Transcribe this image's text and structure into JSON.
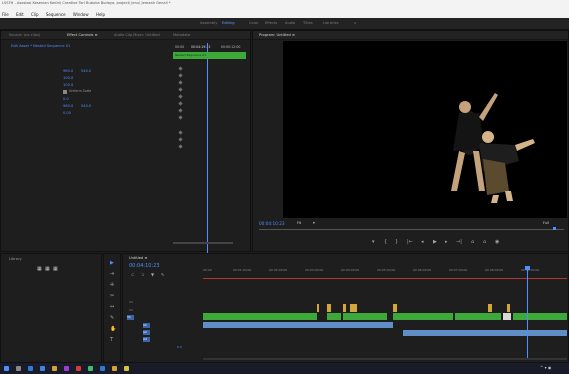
{
  "window": {
    "title": "LSSFH - Asosiasi Kesenian Kediri\\ Creative Tari Bubuka Budaya. project\\ Jenu\\ Jemaah Genail *"
  },
  "menu": [
    "File",
    "Edit",
    "Clip",
    "Sequence",
    "Window",
    "Help"
  ],
  "workspaces": [
    {
      "label": "Assembly",
      "active": false
    },
    {
      "label": "Editing",
      "active": true
    },
    {
      "label": "Color",
      "active": false
    },
    {
      "label": "Effects",
      "active": false
    },
    {
      "label": "Audio",
      "active": false
    },
    {
      "label": "Titles",
      "active": false
    },
    {
      "label": "Libraries",
      "active": false
    }
  ],
  "left_panel": {
    "tabs": [
      {
        "label": "Source: (no clips)",
        "active": false
      },
      {
        "label": "Effect Controls ≡",
        "active": true
      },
      {
        "label": "Audio Clip Mixer: Untitled",
        "active": false
      },
      {
        "label": "Metadata",
        "active": false
      }
    ],
    "clip_path": "Edit Asset * Nested Sequence 01",
    "timecodes": [
      "00:00",
      "00:04:19:23",
      "00:00:12:00"
    ],
    "clip_label": "Nested Sequence 01",
    "values": [
      "960.0",
      "540.0",
      "100.0",
      "100.0",
      "Uniform Scale",
      "0.0",
      "960.0",
      "540.0",
      "0.00"
    ]
  },
  "program_monitor": {
    "title": "Program: Untitled ≡",
    "timecode": "00:04:10:23",
    "fit": "Fit",
    "quality": "Full"
  },
  "project_panel": {
    "label": "Library"
  },
  "timeline": {
    "tab": "Untitled ≡",
    "timecode": "00:04:10:23",
    "ruler": [
      "00:00",
      "00:01:00:00",
      "00:02:00:00",
      "00:03:00:00",
      "00:04:00:00",
      "00:05:00:00",
      "00:06:00:00",
      "00:07:00:00",
      "00:08:00:00",
      "00:09:00:00",
      "00:10:00:00"
    ],
    "tracks": [
      "V3",
      "V2",
      "V1",
      "A1",
      "A2",
      "A3"
    ],
    "master_value": "0.0"
  },
  "colors": {
    "accent": "#4f8eff",
    "video_clip": "#3ca93a",
    "audio_clip": "#5f8fc6",
    "yellow_clip": "#d2a63a",
    "playhead": "#4f8eff"
  }
}
